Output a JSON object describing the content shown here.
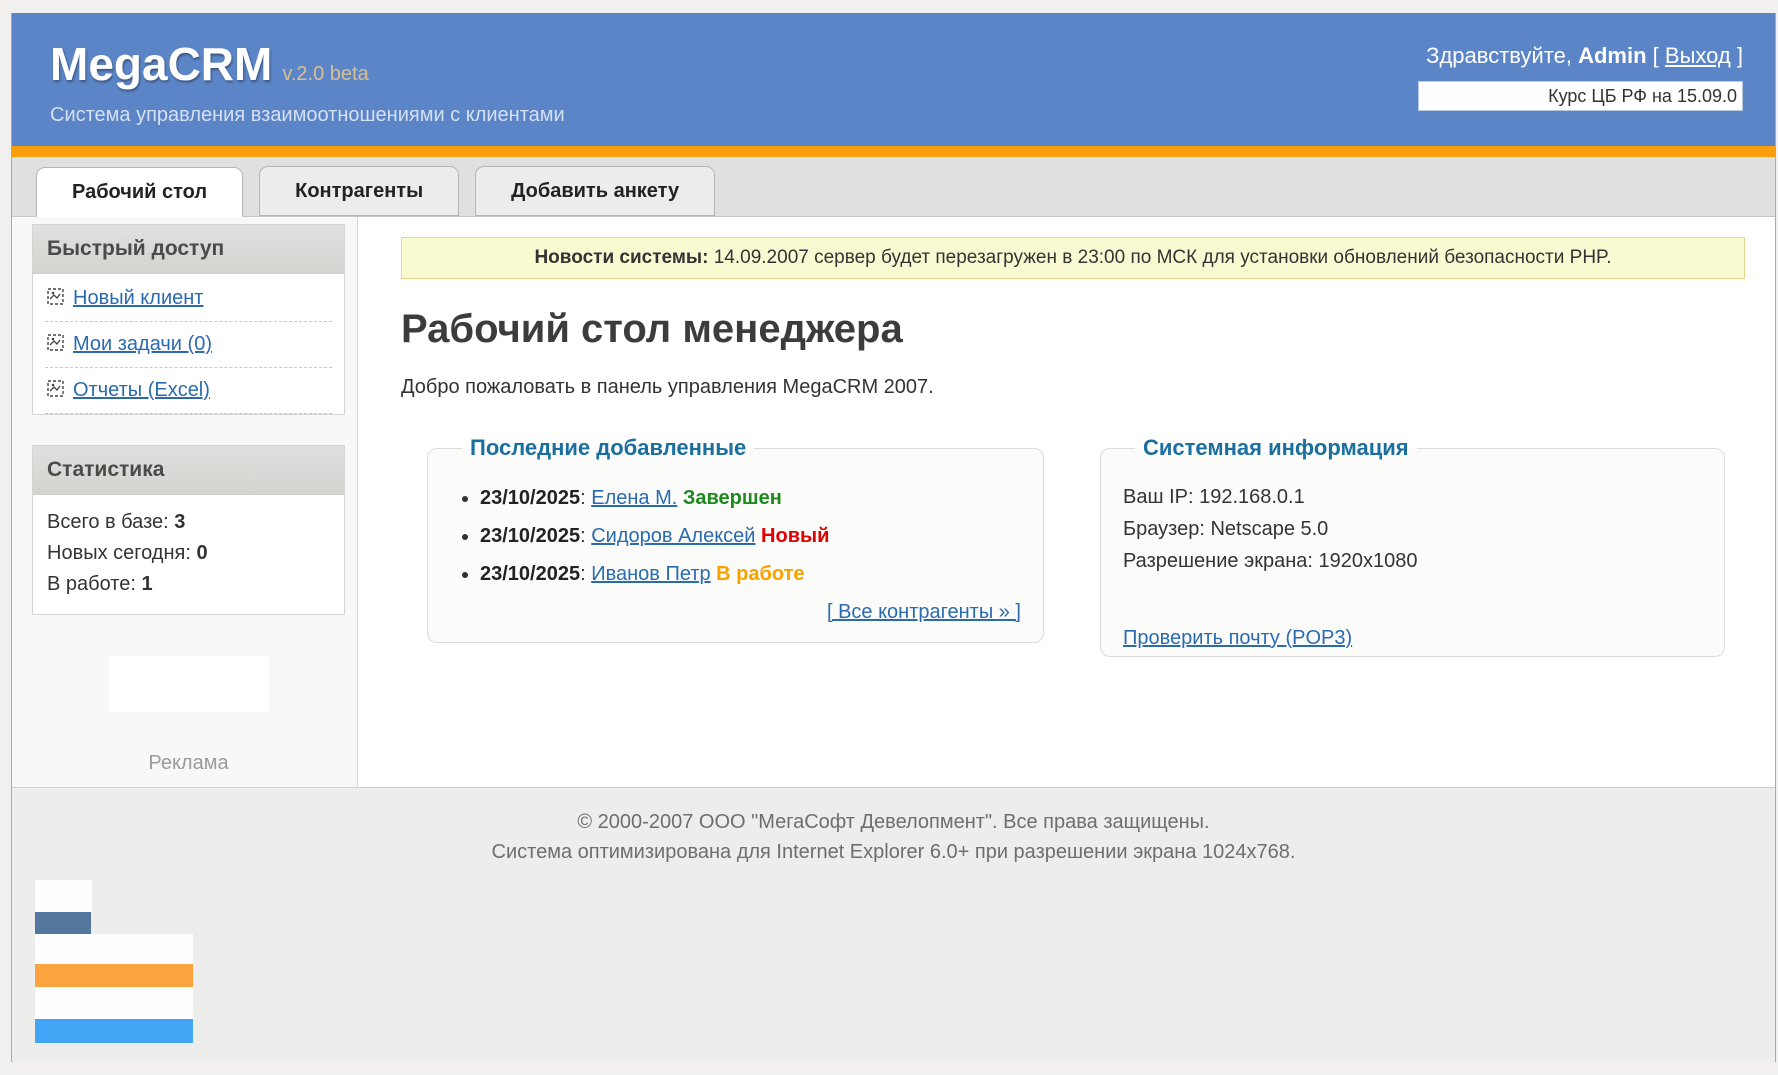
{
  "colors": {
    "header_blue": "#5b85c7",
    "accent_orange": "#fb9e0e",
    "version_tan": "#d8bf92",
    "legend_teal": "#1a6f9f",
    "link_blue": "#2a6bb0",
    "status_done": "#1e8a1e",
    "status_new": "#e10000",
    "status_progress": "#f8a200",
    "news_bg": "#fafad2",
    "news_border": "#e3d88f",
    "banner_steel_blue": "#54779e",
    "banner_orange": "#f9a440",
    "banner_light_blue": "#41a4f4"
  },
  "header": {
    "logo": "MegaCRM",
    "version": "v.2.0 beta",
    "tagline": "Система управления взаимоотношениями с клиентами",
    "greeting_prefix": "Здравствуйте,",
    "username": "Admin",
    "logout_open": "[",
    "logout_label": "Выход",
    "logout_close": "]",
    "ticker": "Курс ЦБ РФ на 15.09.0"
  },
  "tabs": [
    {
      "label": "Рабочий стол",
      "active": true
    },
    {
      "label": "Контрагенты",
      "active": false
    },
    {
      "label": "Добавить анкету",
      "active": false
    }
  ],
  "sidebar": {
    "quick_access": {
      "title": "Быстрый доступ",
      "links": [
        "Новый клиент",
        "Мои задачи (0)",
        "Отчеты (Excel)"
      ]
    },
    "stats": {
      "title": "Статистика",
      "rows": [
        {
          "label": "Всего в базе:",
          "value": "3"
        },
        {
          "label": "Новых сегодня:",
          "value": "0"
        },
        {
          "label": "В работе:",
          "value": "1"
        }
      ]
    },
    "ad_label": "Реклама"
  },
  "main": {
    "news": {
      "label": "Новости системы:",
      "text": "14.09.2007 сервер будет перезагружен в 23:00 по МСК для установки обновлений безопасности PHP."
    },
    "page_title": "Рабочий стол менеджера",
    "welcome": "Добро пожаловать в панель управления MegaCRM 2007.",
    "recent": {
      "legend": "Последние добавленные",
      "items": [
        {
          "date": "23/10/2025",
          "name": "Елена М.",
          "status": "Завершен",
          "status_color": "#1e8a1e"
        },
        {
          "date": "23/10/2025",
          "name": "Сидоров Алексей",
          "status": "Новый",
          "status_color": "#e10000"
        },
        {
          "date": "23/10/2025",
          "name": "Иванов Петр",
          "status": "В работе",
          "status_color": "#f8a200"
        }
      ],
      "all_link": "[ Все контрагенты » ]"
    },
    "sysinfo": {
      "legend": "Системная информация",
      "rows": [
        "Ваш IP: 192.168.0.1",
        "Браузер: Netscape 5.0",
        "Разрешение экрана: 1920x1080"
      ],
      "mail_link": "Проверить почту (POP3)"
    }
  },
  "footer": {
    "line1": "© 2000-2007 ООО \"МегаСофт Девелопмент\". Все права защищены.",
    "line2": "Система оптимизирована для Internet Explorer 6.0+ при разрешении экрана 1024x768."
  }
}
